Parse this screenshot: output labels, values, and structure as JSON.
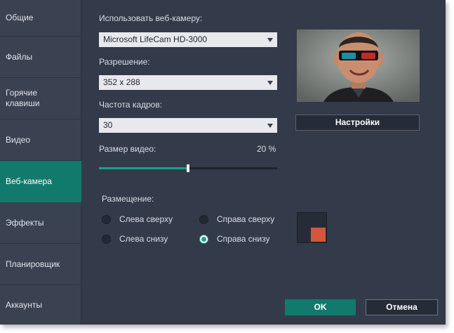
{
  "sidebar": {
    "items": [
      {
        "label": "Общие",
        "active": false
      },
      {
        "label": "Файлы",
        "active": false
      },
      {
        "label": "Горячие\nклавиши",
        "active": false
      },
      {
        "label": "Видео",
        "active": false
      },
      {
        "label": "Веб-камера",
        "active": true
      },
      {
        "label": "Эффекты",
        "active": false
      },
      {
        "label": "Планировщик",
        "active": false
      },
      {
        "label": "Аккаунты",
        "active": false
      }
    ]
  },
  "webcam": {
    "use_label": "Использовать веб-камеру:",
    "device_value": "Microsoft LifeCam HD-3000",
    "resolution_label": "Разрешение:",
    "resolution_value": "352 x 288",
    "framerate_label": "Частота кадров:",
    "framerate_value": "30",
    "size_label": "Размер видео:",
    "size_value_text": "20 %",
    "size_slider_fraction": 0.5,
    "settings_button": "Настройки"
  },
  "placement": {
    "label": "Размещение:",
    "options": [
      {
        "label": "Слева сверху",
        "checked": false
      },
      {
        "label": "Справа сверху",
        "checked": false
      },
      {
        "label": "Слева снизу",
        "checked": false
      },
      {
        "label": "Справа снизу",
        "checked": true
      }
    ]
  },
  "footer": {
    "ok_label": "OK",
    "cancel_label": "Отмена"
  },
  "colors": {
    "accent": "#117a6c",
    "slider_fill": "#1ba08c",
    "preview_marker": "#d2583b",
    "panel_bg": "#333b4a",
    "sidebar_bg": "#3a4252"
  }
}
